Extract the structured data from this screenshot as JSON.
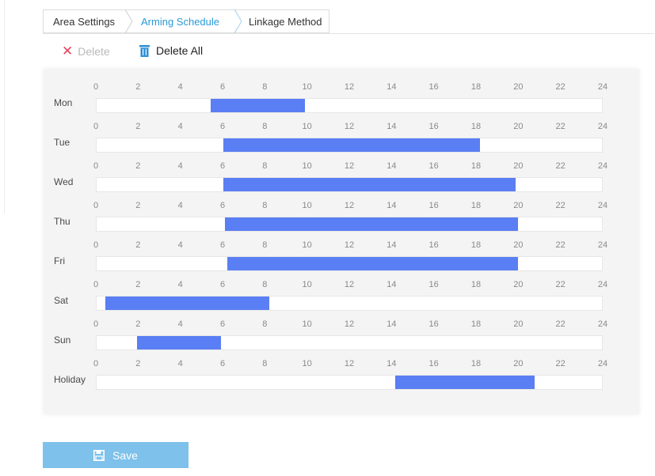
{
  "tabs": [
    {
      "label": "Area Settings"
    },
    {
      "label": "Arming Schedule",
      "active": true
    },
    {
      "label": "Linkage Method"
    }
  ],
  "toolbar": {
    "delete_label": "Delete",
    "delete_all_label": "Delete All"
  },
  "schedule": {
    "hour_ticks": [
      "0",
      "2",
      "4",
      "6",
      "8",
      "10",
      "12",
      "14",
      "16",
      "18",
      "20",
      "22",
      "24"
    ],
    "days": [
      {
        "label": "Mon",
        "segments": [
          {
            "start": 5.4,
            "end": 9.9
          }
        ]
      },
      {
        "label": "Tue",
        "segments": [
          {
            "start": 6.0,
            "end": 18.2
          }
        ]
      },
      {
        "label": "Wed",
        "segments": [
          {
            "start": 6.0,
            "end": 19.9
          }
        ]
      },
      {
        "label": "Thu",
        "segments": [
          {
            "start": 6.1,
            "end": 20.0
          }
        ]
      },
      {
        "label": "Fri",
        "segments": [
          {
            "start": 6.2,
            "end": 20.0
          }
        ]
      },
      {
        "label": "Sat",
        "segments": [
          {
            "start": 0.4,
            "end": 8.2
          }
        ]
      },
      {
        "label": "Sun",
        "segments": [
          {
            "start": 1.9,
            "end": 5.9
          }
        ]
      },
      {
        "label": "Holiday",
        "segments": [
          {
            "start": 14.2,
            "end": 20.8
          }
        ]
      }
    ]
  },
  "save_label": "Save",
  "colors": {
    "segment": "#5a7ef3",
    "active_tab": "#2a9ad6",
    "save_button": "#7ec1ea",
    "delete_icon": "#e2445c"
  }
}
